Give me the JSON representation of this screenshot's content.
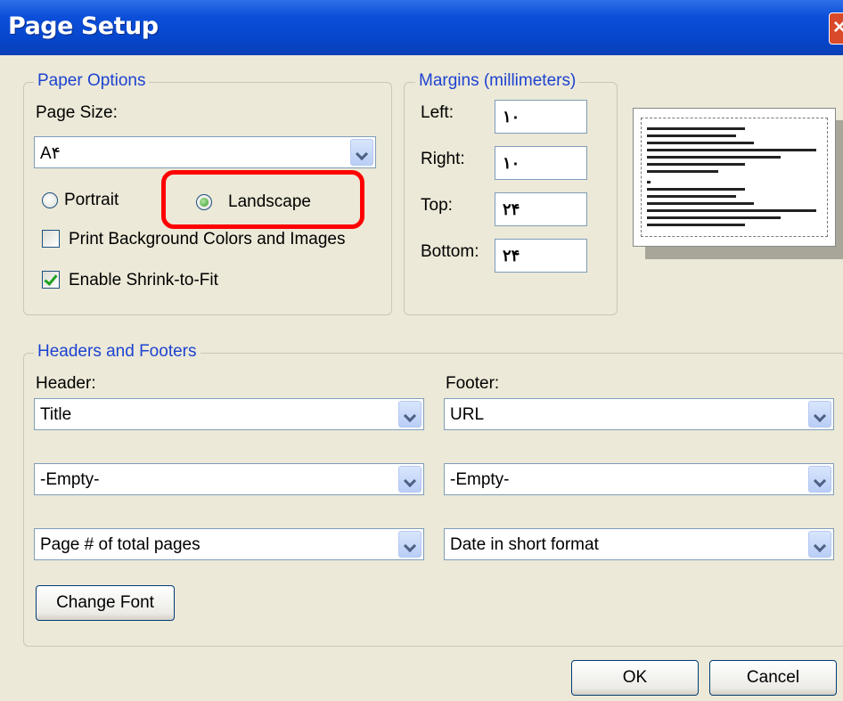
{
  "window": {
    "title": "Page Setup"
  },
  "paper_options": {
    "legend": "Paper Options",
    "page_size_label": "Page Size:",
    "page_size_value": "A۴",
    "orientation": {
      "portrait_label": "Portrait",
      "landscape_label": "Landscape",
      "selected": "Landscape"
    },
    "print_background_label": "Print Background Colors and Images",
    "print_background_checked": false,
    "shrink_to_fit_label": "Enable Shrink-to-Fit",
    "shrink_to_fit_checked": true
  },
  "margins": {
    "legend": "Margins (millimeters)",
    "left_label": "Left:",
    "left_value": "۱۰",
    "right_label": "Right:",
    "right_value": "۱۰",
    "top_label": "Top:",
    "top_value": "۲۴",
    "bottom_label": "Bottom:",
    "bottom_value": "۲۴"
  },
  "headers_footers": {
    "legend": "Headers and Footers",
    "header_label": "Header:",
    "footer_label": "Footer:",
    "header_values": [
      "Title",
      "-Empty-",
      "Page # of total pages"
    ],
    "footer_values": [
      "URL",
      "-Empty-",
      "Date in short format"
    ],
    "change_font_label": "Change Font"
  },
  "buttons": {
    "ok_label": "OK",
    "cancel_label": "Cancel"
  },
  "colors": {
    "titlebar": "#0646CC",
    "legend_text": "#1D43D0",
    "highlight": "#FF0000",
    "dialog_bg": "#ECE9D8"
  }
}
